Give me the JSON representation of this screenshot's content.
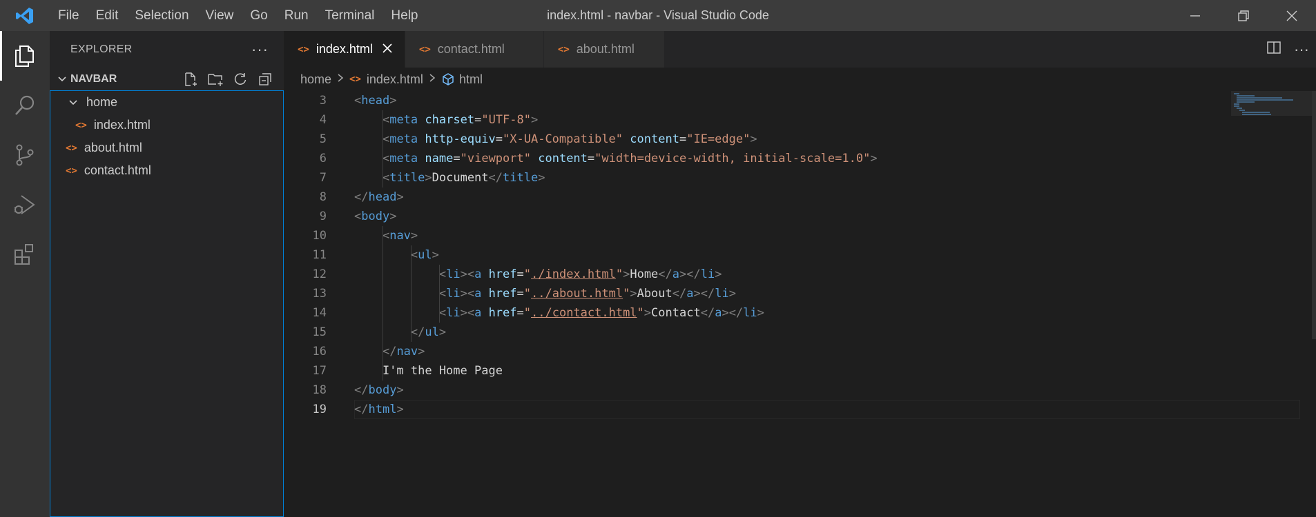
{
  "titlebar": {
    "menu": [
      "File",
      "Edit",
      "Selection",
      "View",
      "Go",
      "Run",
      "Terminal",
      "Help"
    ],
    "window_title": "index.html - navbar - Visual Studio Code"
  },
  "activity_bar": {
    "items": [
      "explorer-icon",
      "search-icon",
      "source-control-icon",
      "run-debug-icon",
      "extensions-icon"
    ]
  },
  "sidebar": {
    "title": "EXPLORER",
    "section": "NAVBAR",
    "tree": [
      {
        "label": "home",
        "type": "folder"
      },
      {
        "label": "index.html",
        "type": "file"
      },
      {
        "label": "about.html",
        "type": "file"
      },
      {
        "label": "contact.html",
        "type": "file"
      }
    ]
  },
  "tabs": [
    {
      "label": "index.html",
      "active": true
    },
    {
      "label": "contact.html",
      "active": false
    },
    {
      "label": "about.html",
      "active": false
    }
  ],
  "breadcrumb": {
    "folder": "home",
    "file": "index.html",
    "symbol": "html"
  },
  "editor": {
    "current_line": 19,
    "lines": [
      {
        "n": 3,
        "code": "<head>"
      },
      {
        "n": 4,
        "code": "    <meta charset=\"UTF-8\">"
      },
      {
        "n": 5,
        "code": "    <meta http-equiv=\"X-UA-Compatible\" content=\"IE=edge\">"
      },
      {
        "n": 6,
        "code": "    <meta name=\"viewport\" content=\"width=device-width, initial-scale=1.0\">"
      },
      {
        "n": 7,
        "code": "    <title>Document</title>"
      },
      {
        "n": 8,
        "code": "</head>"
      },
      {
        "n": 9,
        "code": "<body>"
      },
      {
        "n": 10,
        "code": "    <nav>"
      },
      {
        "n": 11,
        "code": "        <ul>"
      },
      {
        "n": 12,
        "code": "            <li><a href=\"./index.html\">Home</a></li>"
      },
      {
        "n": 13,
        "code": "            <li><a href=\"../about.html\">About</a></li>"
      },
      {
        "n": 14,
        "code": "            <li><a href=\"../contact.html\">Contact</a></li>"
      },
      {
        "n": 15,
        "code": "        </ul>"
      },
      {
        "n": 16,
        "code": "    </nav>"
      },
      {
        "n": 17,
        "code": "    I'm the Home Page"
      },
      {
        "n": 18,
        "code": "</body>"
      },
      {
        "n": 19,
        "code": "</html>"
      }
    ]
  },
  "colors": {
    "tag": "#569cd6",
    "attribute": "#9cdcfe",
    "string": "#ce9178",
    "text": "#d4d4d4",
    "html_file_icon": "#e37933",
    "focus_border": "#007fd4"
  }
}
